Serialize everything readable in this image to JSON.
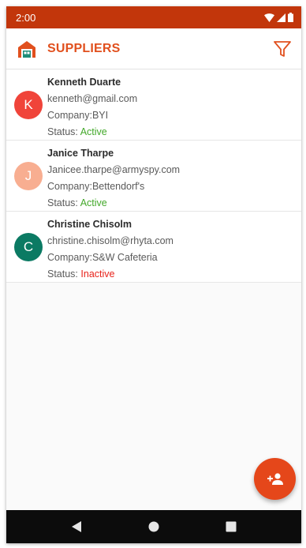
{
  "status_bar": {
    "time": "2:00",
    "icons": [
      "wifi-icon",
      "signal-icon",
      "battery-icon"
    ]
  },
  "app_bar": {
    "logo_icon": "warehouse-icon",
    "title": "SUPPLIERS",
    "filter_icon": "filter-icon"
  },
  "suppliers": [
    {
      "initial": "K",
      "avatar_color": "#f0443a",
      "name": "Kenneth Duarte",
      "email": "kenneth@gmail.com",
      "company": "Company:BYI",
      "status_label": "Status: ",
      "status": "Active",
      "status_color": "#43a82a"
    },
    {
      "initial": "J",
      "avatar_color": "#f8ae91",
      "name": "Janice Tharpe",
      "email": "Janicee.tharpe@armyspy.com",
      "company": "Company:Bettendorf's",
      "status_label": "Status: ",
      "status": "Active",
      "status_color": "#43a82a"
    },
    {
      "initial": "C",
      "avatar_color": "#0b7a63",
      "name": "Christine Chisolm",
      "email": "christine.chisolm@rhyta.com",
      "company": "Company:S&W Cafeteria",
      "status_label": "Status: ",
      "status": "Inactive",
      "status_color": "#e8231b"
    }
  ],
  "fab": {
    "icon": "add-person-icon"
  },
  "nav_bar": {
    "icons": [
      "back-icon",
      "home-icon",
      "recents-icon"
    ]
  },
  "colors": {
    "status_bar": "#c2360b",
    "accent": "#e1501e",
    "fab": "#e5471a"
  }
}
